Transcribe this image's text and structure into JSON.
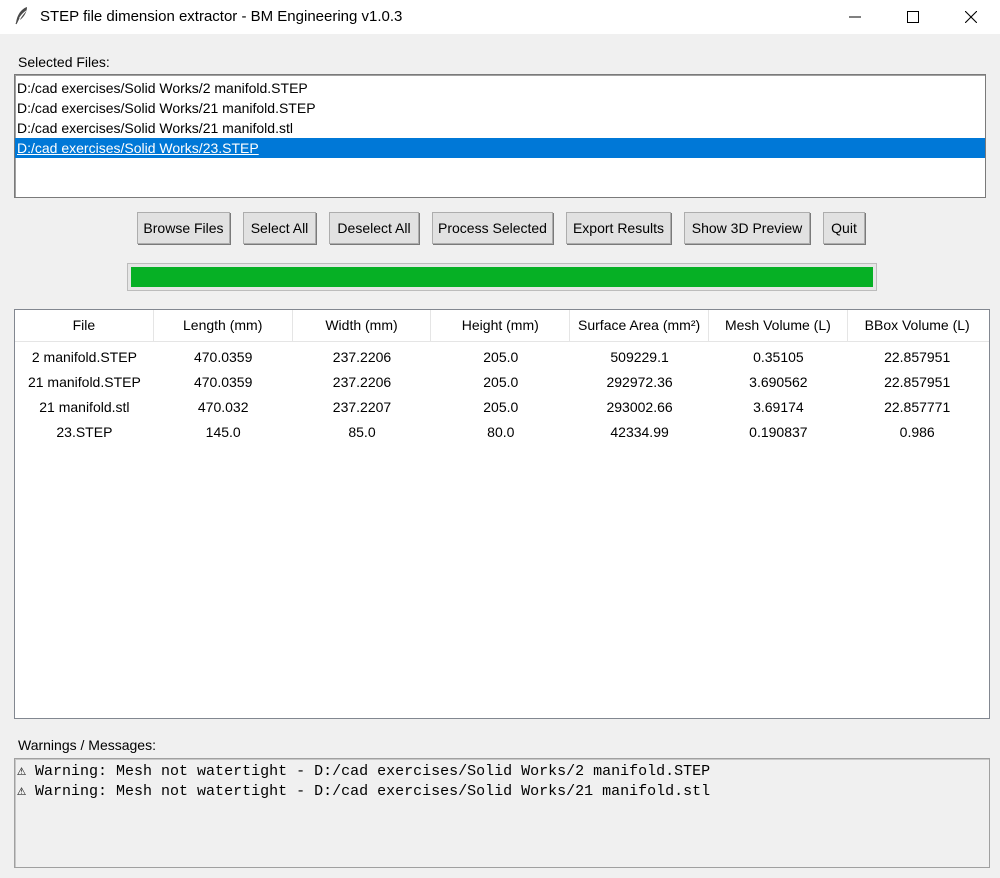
{
  "window": {
    "title": "STEP file dimension extractor - BM Engineering v1.0.3",
    "icon": "feather-icon"
  },
  "files": {
    "label": "Selected Files:",
    "items": [
      "D:/cad exercises/Solid Works/2 manifold.STEP",
      "D:/cad exercises/Solid Works/21 manifold.STEP",
      "D:/cad exercises/Solid Works/21 manifold.stl",
      "D:/cad exercises/Solid Works/23.STEP"
    ],
    "selected_index": 3
  },
  "toolbar": {
    "browse": "Browse Files",
    "select_all": "Select All",
    "deselect_all": "Deselect All",
    "process": "Process Selected",
    "export": "Export Results",
    "preview": "Show 3D Preview",
    "quit": "Quit"
  },
  "progress": {
    "value": 1.0,
    "color": "#06b025"
  },
  "results": {
    "columns": [
      "File",
      "Length (mm)",
      "Width (mm)",
      "Height (mm)",
      "Surface Area (mm²)",
      "Mesh Volume (L)",
      "BBox Volume (L)"
    ],
    "rows": [
      [
        "2 manifold.STEP",
        "470.0359",
        "237.2206",
        "205.0",
        "509229.1",
        "0.35105",
        "22.857951"
      ],
      [
        "21 manifold.STEP",
        "470.0359",
        "237.2206",
        "205.0",
        "292972.36",
        "3.690562",
        "22.857951"
      ],
      [
        "21 manifold.stl",
        "470.032",
        "237.2207",
        "205.0",
        "293002.66",
        "3.69174",
        "22.857771"
      ],
      [
        "23.STEP",
        "145.0",
        "85.0",
        "80.0",
        "42334.99",
        "0.190837",
        "0.986"
      ]
    ]
  },
  "messages": {
    "label": "Warnings / Messages:",
    "items": [
      "⚠ Warning: Mesh not watertight - D:/cad exercises/Solid Works/2 manifold.STEP",
      "⚠ Warning: Mesh not watertight - D:/cad exercises/Solid Works/21 manifold.stl"
    ]
  },
  "colors": {
    "selection": "#0078d7",
    "progress": "#06b025"
  }
}
